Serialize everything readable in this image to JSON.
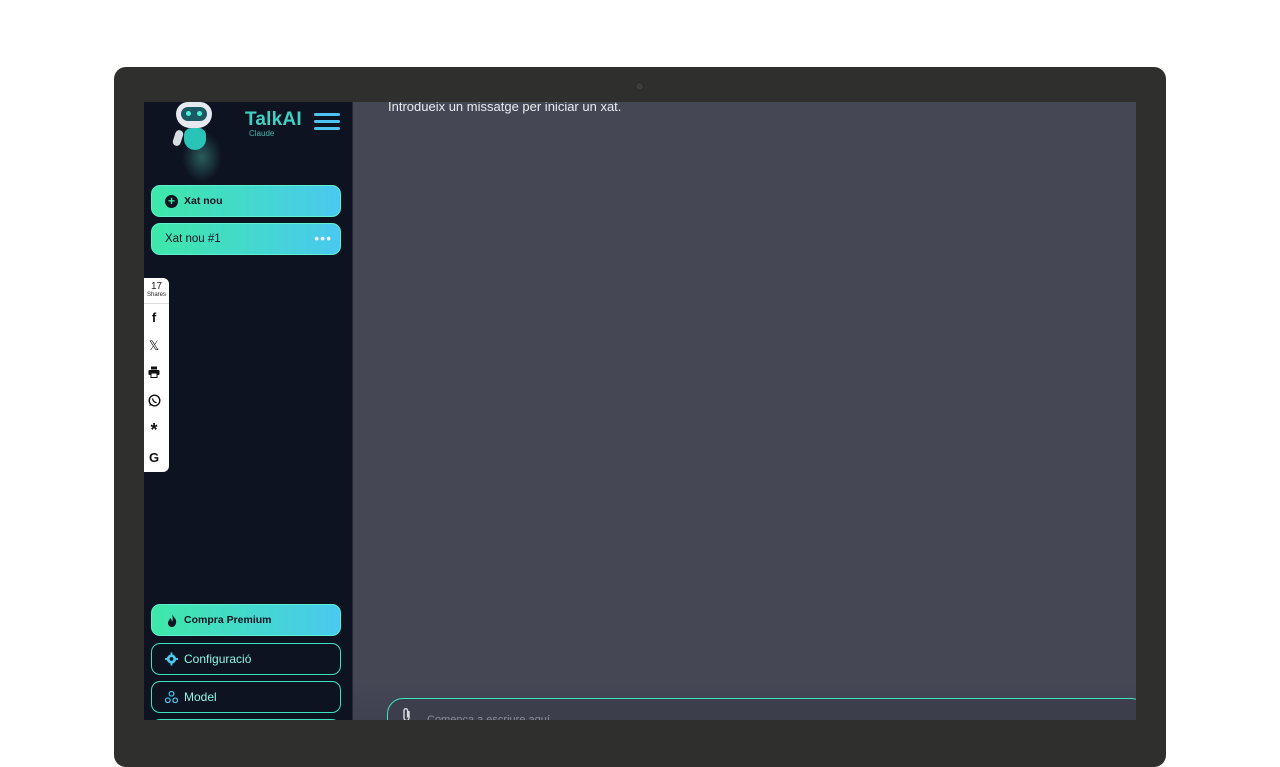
{
  "app": {
    "logo_title": "TalkAI",
    "logo_subtitle": "Claude"
  },
  "sidebar": {
    "new_chat_label": "Xat nou",
    "chats": [
      {
        "label": "Xat nou #1",
        "menu_icon": "ellipsis-icon"
      }
    ],
    "premium_label": "Compra Premium",
    "settings_label": "Configuració",
    "model_label": "Model"
  },
  "share": {
    "count": "17",
    "count_label": "Shares",
    "items": [
      "facebook-icon",
      "x-icon",
      "print-icon",
      "whatsapp-icon",
      "asterisk-icon",
      "google-icon"
    ]
  },
  "main": {
    "empty_message": "Introdueix un missatge per iniciar un xat.",
    "composer_placeholder": "Comença a escriure aquí..."
  },
  "colors": {
    "accent_green": "#3ee8a8",
    "accent_blue": "#49c9f0",
    "sidebar_bg": "#0e1322",
    "main_bg": "#454755"
  }
}
